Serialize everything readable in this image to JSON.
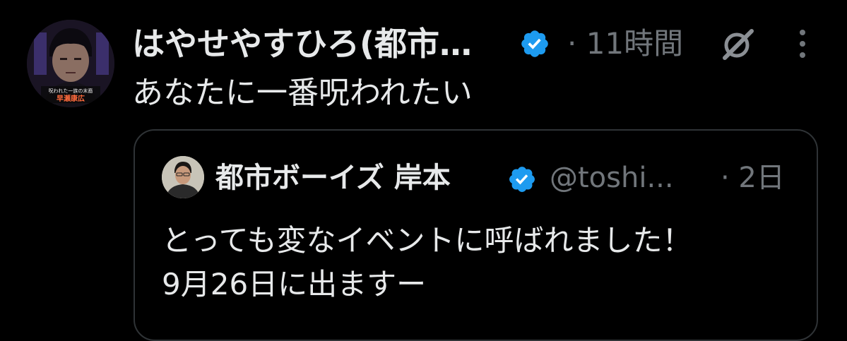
{
  "post": {
    "author_name": "はやせやすひろ(都市…",
    "time": "· 11時間",
    "text": "あなたに一番呪われたい",
    "avatar_caption_top": "呪われた一族の末裔",
    "avatar_caption_bottom": "早瀬康広"
  },
  "quoted_post": {
    "author_name": "都市ボーイズ 岸本",
    "handle": "@toshi...",
    "time": "· 2日",
    "text_lines": [
      "とっても変なイベントに呼ばれました！",
      "9月26日に出ますー"
    ]
  },
  "icons": {
    "verified": "verified-badge-icon",
    "grok": "grok-icon",
    "more": "more-options-icon"
  },
  "colors": {
    "background": "#000000",
    "primary_text": "#e7e9ea",
    "secondary_text": "#71767b",
    "verified_blue": "#1d9bf0",
    "border": "#2f3336"
  }
}
